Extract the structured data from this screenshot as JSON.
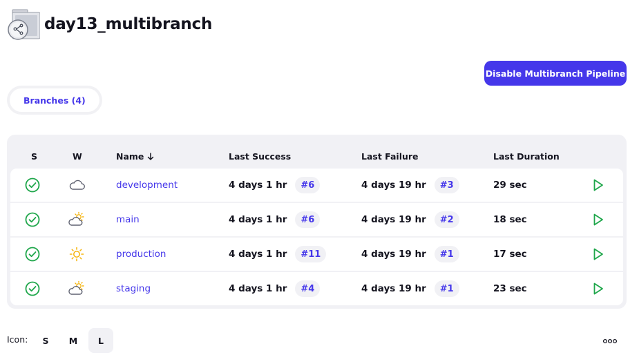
{
  "page": {
    "title": "day13_multibranch"
  },
  "actions": {
    "disable_label": "Disable Multibranch Pipeline"
  },
  "tabs": [
    {
      "label": "Branches (4)"
    }
  ],
  "table": {
    "headers": {
      "status": "S",
      "weather": "W",
      "name": "Name",
      "last_success": "Last Success",
      "last_failure": "Last Failure",
      "last_duration": "Last Duration"
    },
    "rows": [
      {
        "status_icon": "success-icon",
        "weather_icon": "cloudy-icon",
        "name": "development",
        "last_success": "4 days 1 hr",
        "last_success_build": "#6",
        "last_failure": "4 days 19 hr",
        "last_failure_build": "#3",
        "last_duration": "29 sec"
      },
      {
        "status_icon": "success-icon",
        "weather_icon": "partly-sunny-icon",
        "name": "main",
        "last_success": "4 days 1 hr",
        "last_success_build": "#6",
        "last_failure": "4 days 19 hr",
        "last_failure_build": "#2",
        "last_duration": "18 sec"
      },
      {
        "status_icon": "success-icon",
        "weather_icon": "sunny-icon",
        "name": "production",
        "last_success": "4 days 1 hr",
        "last_success_build": "#11",
        "last_failure": "4 days 19 hr",
        "last_failure_build": "#1",
        "last_duration": "17 sec"
      },
      {
        "status_icon": "success-icon",
        "weather_icon": "partly-sunny-icon",
        "name": "staging",
        "last_success": "4 days 1 hr",
        "last_success_build": "#4",
        "last_failure": "4 days 19 hr",
        "last_failure_build": "#1",
        "last_duration": "23 sec"
      }
    ]
  },
  "footer": {
    "icon_label": "Icon:",
    "sizes": [
      "S",
      "M",
      "L"
    ],
    "selected_size": "L"
  },
  "colors": {
    "accent": "#4537ea",
    "success": "#1ea64a",
    "sun": "#f5b30a"
  }
}
